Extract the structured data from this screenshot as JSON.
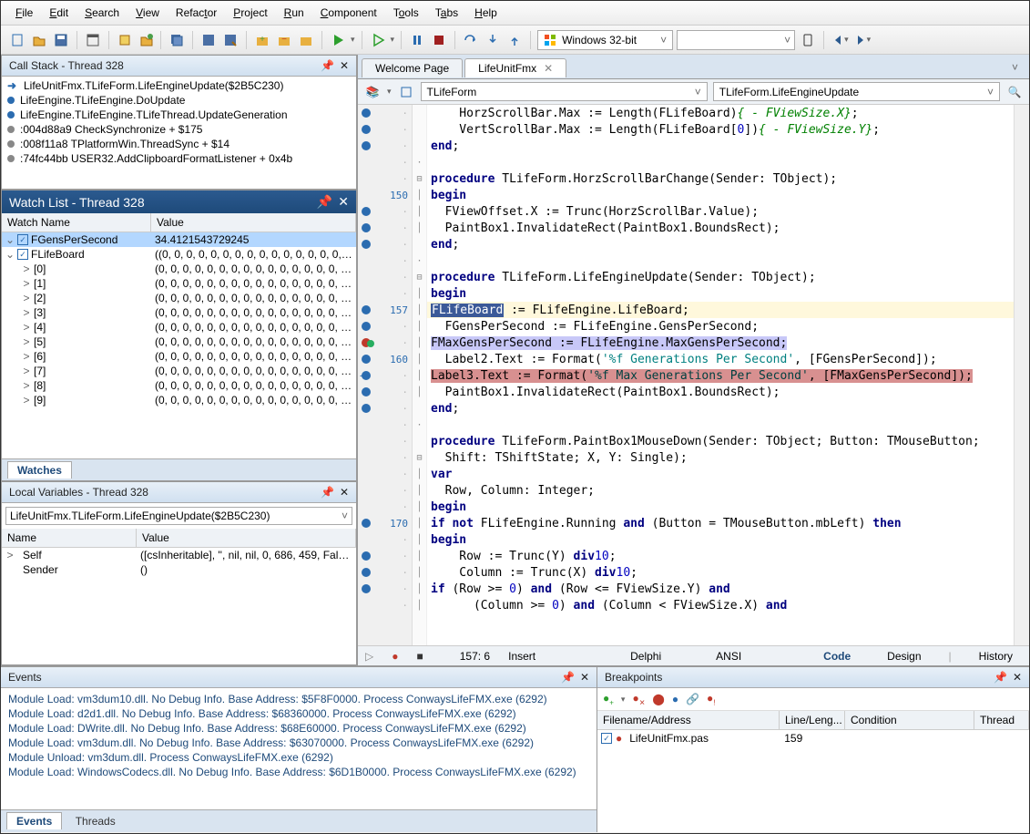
{
  "menu": [
    "File",
    "Edit",
    "Search",
    "View",
    "Refactor",
    "Project",
    "Run",
    "Component",
    "Tools",
    "Tabs",
    "Help"
  ],
  "platform": "Windows 32-bit",
  "callstack": {
    "title": "Call Stack - Thread 328",
    "rows": [
      {
        "icon": "arrow",
        "text": "LifeUnitFmx.TLifeForm.LifeEngineUpdate($2B5C230)"
      },
      {
        "icon": "blue",
        "text": "LifeEngine.TLifeEngine.DoUpdate"
      },
      {
        "icon": "blue",
        "text": "LifeEngine.TLifeEngine.TLifeThread.UpdateGeneration"
      },
      {
        "icon": "gray",
        "text": ":004d88a9 CheckSynchronize + $175"
      },
      {
        "icon": "gray",
        "text": ":008f11a8 TPlatformWin.ThreadSync + $14"
      },
      {
        "icon": "gray",
        "text": ":74fc44bb USER32.AddClipboardFormatListener + 0x4b"
      }
    ]
  },
  "watch": {
    "title": "Watch List - Thread 328",
    "col1": "Watch Name",
    "col2": "Value",
    "rows": [
      {
        "sel": true,
        "chk": true,
        "exp": "v",
        "name": "FGensPerSecond",
        "val": "34.4121543729245"
      },
      {
        "chk": true,
        "exp": "v",
        "name": "FLifeBoard",
        "val": "((0, 0, 0, 0, 0, 0, 0, 0, 0, 0, 0, 0, 0, 0, 0, 0, ..."
      },
      {
        "ind": 1,
        "exp": ">",
        "name": "[0]",
        "val": "(0, 0, 0, 0, 0, 0, 0, 0, 0, 0, 0, 0, 0, 0, 0, 0, ..."
      },
      {
        "ind": 1,
        "exp": ">",
        "name": "[1]",
        "val": "(0, 0, 0, 0, 0, 0, 0, 0, 0, 0, 0, 0, 0, 0, 0, 0, ..."
      },
      {
        "ind": 1,
        "exp": ">",
        "name": "[2]",
        "val": "(0, 0, 0, 0, 0, 0, 0, 0, 0, 0, 0, 0, 0, 0, 0, 0, ..."
      },
      {
        "ind": 1,
        "exp": ">",
        "name": "[3]",
        "val": "(0, 0, 0, 0, 0, 0, 0, 0, 0, 0, 0, 0, 0, 0, 0, 0, ..."
      },
      {
        "ind": 1,
        "exp": ">",
        "name": "[4]",
        "val": "(0, 0, 0, 0, 0, 0, 0, 0, 0, 0, 0, 0, 0, 0, 0, 0, ..."
      },
      {
        "ind": 1,
        "exp": ">",
        "name": "[5]",
        "val": "(0, 0, 0, 0, 0, 0, 0, 0, 0, 0, 0, 0, 0, 0, 0, 0, ..."
      },
      {
        "ind": 1,
        "exp": ">",
        "name": "[6]",
        "val": "(0, 0, 0, 0, 0, 0, 0, 0, 0, 0, 0, 0, 0, 0, 0, 0, ..."
      },
      {
        "ind": 1,
        "exp": ">",
        "name": "[7]",
        "val": "(0, 0, 0, 0, 0, 0, 0, 0, 0, 0, 0, 0, 0, 0, 0, 0, ..."
      },
      {
        "ind": 1,
        "exp": ">",
        "name": "[8]",
        "val": "(0, 0, 0, 0, 0, 0, 0, 0, 0, 0, 0, 0, 0, 0, 0, 0, ..."
      },
      {
        "ind": 1,
        "exp": ">",
        "name": "[9]",
        "val": "(0, 0, 0, 0, 0, 0, 0, 0, 0, 0, 0, 0, 0, 0, 0, 0, ..."
      }
    ],
    "tab": "Watches"
  },
  "locals": {
    "title": "Local Variables - Thread 328",
    "scope": "LifeUnitFmx.TLifeForm.LifeEngineUpdate($2B5C230)",
    "col1": "Name",
    "col2": "Value",
    "rows": [
      {
        "exp": ">",
        "name": "Self",
        "val": "([csInheritable], '', nil, nil, 0, 686, 459, Fals..."
      },
      {
        "name": "Sender",
        "val": "()"
      }
    ]
  },
  "editor": {
    "tabs": [
      {
        "label": "Welcome Page",
        "active": false
      },
      {
        "label": "LifeUnitFmx",
        "active": true,
        "close": true
      }
    ],
    "class_combo": "TLifeForm",
    "method_combo": "TLifeForm.LifeEngineUpdate",
    "cursor": "157:  6",
    "mode": "Insert",
    "lang": "Delphi",
    "enc": "ANSI",
    "view_tabs": [
      "Code",
      "Design",
      "History"
    ]
  },
  "events": {
    "title": "Events",
    "rows": [
      "Module Load: vm3dum10.dll. No Debug Info. Base Address: $5F8F0000. Process ConwaysLifeFMX.exe (6292)",
      "Module Load: d2d1.dll. No Debug Info. Base Address: $68360000. Process ConwaysLifeFMX.exe (6292)",
      "Module Load: DWrite.dll. No Debug Info. Base Address: $68E60000. Process ConwaysLifeFMX.exe (6292)",
      "Module Load: vm3dum.dll. No Debug Info. Base Address: $63070000. Process ConwaysLifeFMX.exe (6292)",
      "Module Unload: vm3dum.dll. Process ConwaysLifeFMX.exe (6292)",
      "Module Load: WindowsCodecs.dll. No Debug Info. Base Address: $6D1B0000. Process ConwaysLifeFMX.exe (6292)"
    ],
    "tabs": [
      "Events",
      "Threads"
    ]
  },
  "breakpoints": {
    "title": "Breakpoints",
    "cols": [
      "Filename/Address",
      "Line/Leng...",
      "Condition",
      "Thread"
    ],
    "rows": [
      {
        "file": "LifeUnitFmx.pas",
        "line": "159"
      }
    ]
  }
}
